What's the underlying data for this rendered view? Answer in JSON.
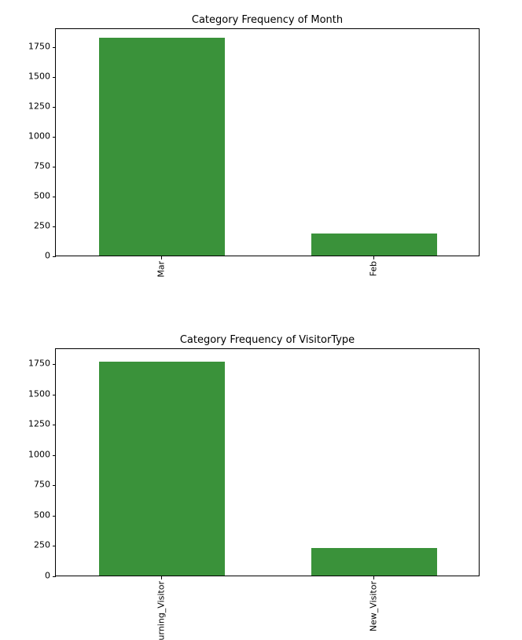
{
  "chart_data": [
    {
      "type": "bar",
      "title": "Category Frequency of Month",
      "categories": [
        "Mar",
        "Feb"
      ],
      "values": [
        1820,
        185
      ],
      "ylim": [
        0,
        1900
      ],
      "yticks": [
        0,
        250,
        500,
        750,
        1000,
        1250,
        1500,
        1750
      ],
      "xlabel": "",
      "ylabel": "",
      "color": "#3a923a"
    },
    {
      "type": "bar",
      "title": "Category Frequency of VisitorType",
      "categories": [
        "urning_Visitor",
        "New_Visitor"
      ],
      "values": [
        1770,
        225
      ],
      "ylim": [
        0,
        1880
      ],
      "yticks": [
        0,
        250,
        500,
        750,
        1000,
        1250,
        1500,
        1750
      ],
      "xlabel": "",
      "ylabel": "",
      "color": "#3a923a"
    }
  ]
}
